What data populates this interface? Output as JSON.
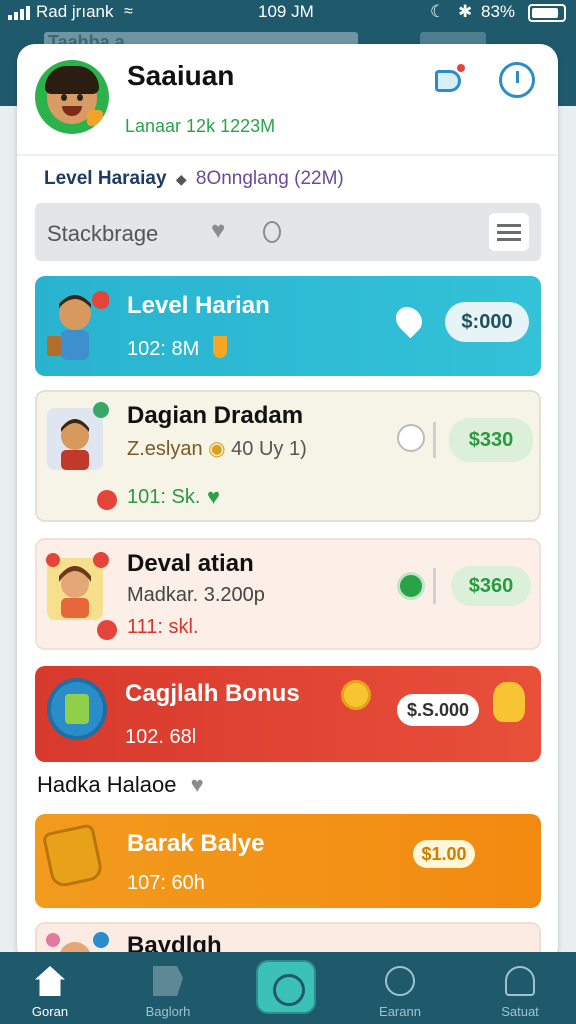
{
  "status_bar": {
    "carrier": "Rad jrıank",
    "time": "109 JM",
    "battery": "83%"
  },
  "header": {
    "ghost_tab": "Taahba a"
  },
  "profile": {
    "name": "Saaiuan",
    "subline": "Lanaar 12k 1223M"
  },
  "level": {
    "label": "Level Haraiay",
    "value": "8Onnglang (22M)"
  },
  "search": {
    "text": "Stackbrage"
  },
  "tasks": [
    {
      "title": "Level Harian",
      "sub": "102: 8M",
      "price": "$:000"
    },
    {
      "title": "Dagian Dradam",
      "sub": "Z.eslyan",
      "sub_extra": "40 Uy 1)",
      "sub2": "101: Sk.",
      "price": "$330"
    },
    {
      "title": "Deval atian",
      "sub": "Madkar. 3.200p",
      "sub2": "111: skl.",
      "price": "$360"
    },
    {
      "title": "Cagjlalh Bonus",
      "sub": "102. 68l",
      "price": "$.S.000"
    },
    {
      "title": "Barak Balye",
      "sub": "107: 60h",
      "price": "$1.00"
    },
    {
      "title": "Baydlgh"
    }
  ],
  "section2": {
    "label": "Hadka Halaoe"
  },
  "tabbar": {
    "items": [
      {
        "label": "Goran"
      },
      {
        "label": "Baglorh"
      },
      {
        "label": ""
      },
      {
        "label": "Earann"
      },
      {
        "label": "Satuat"
      }
    ]
  },
  "colors": {
    "header_bg": "#1f5a6c",
    "accent_green": "#2aa348",
    "teal_card": "#29b3cf",
    "red_card": "#d8392d",
    "orange_card": "#f29b1e"
  }
}
